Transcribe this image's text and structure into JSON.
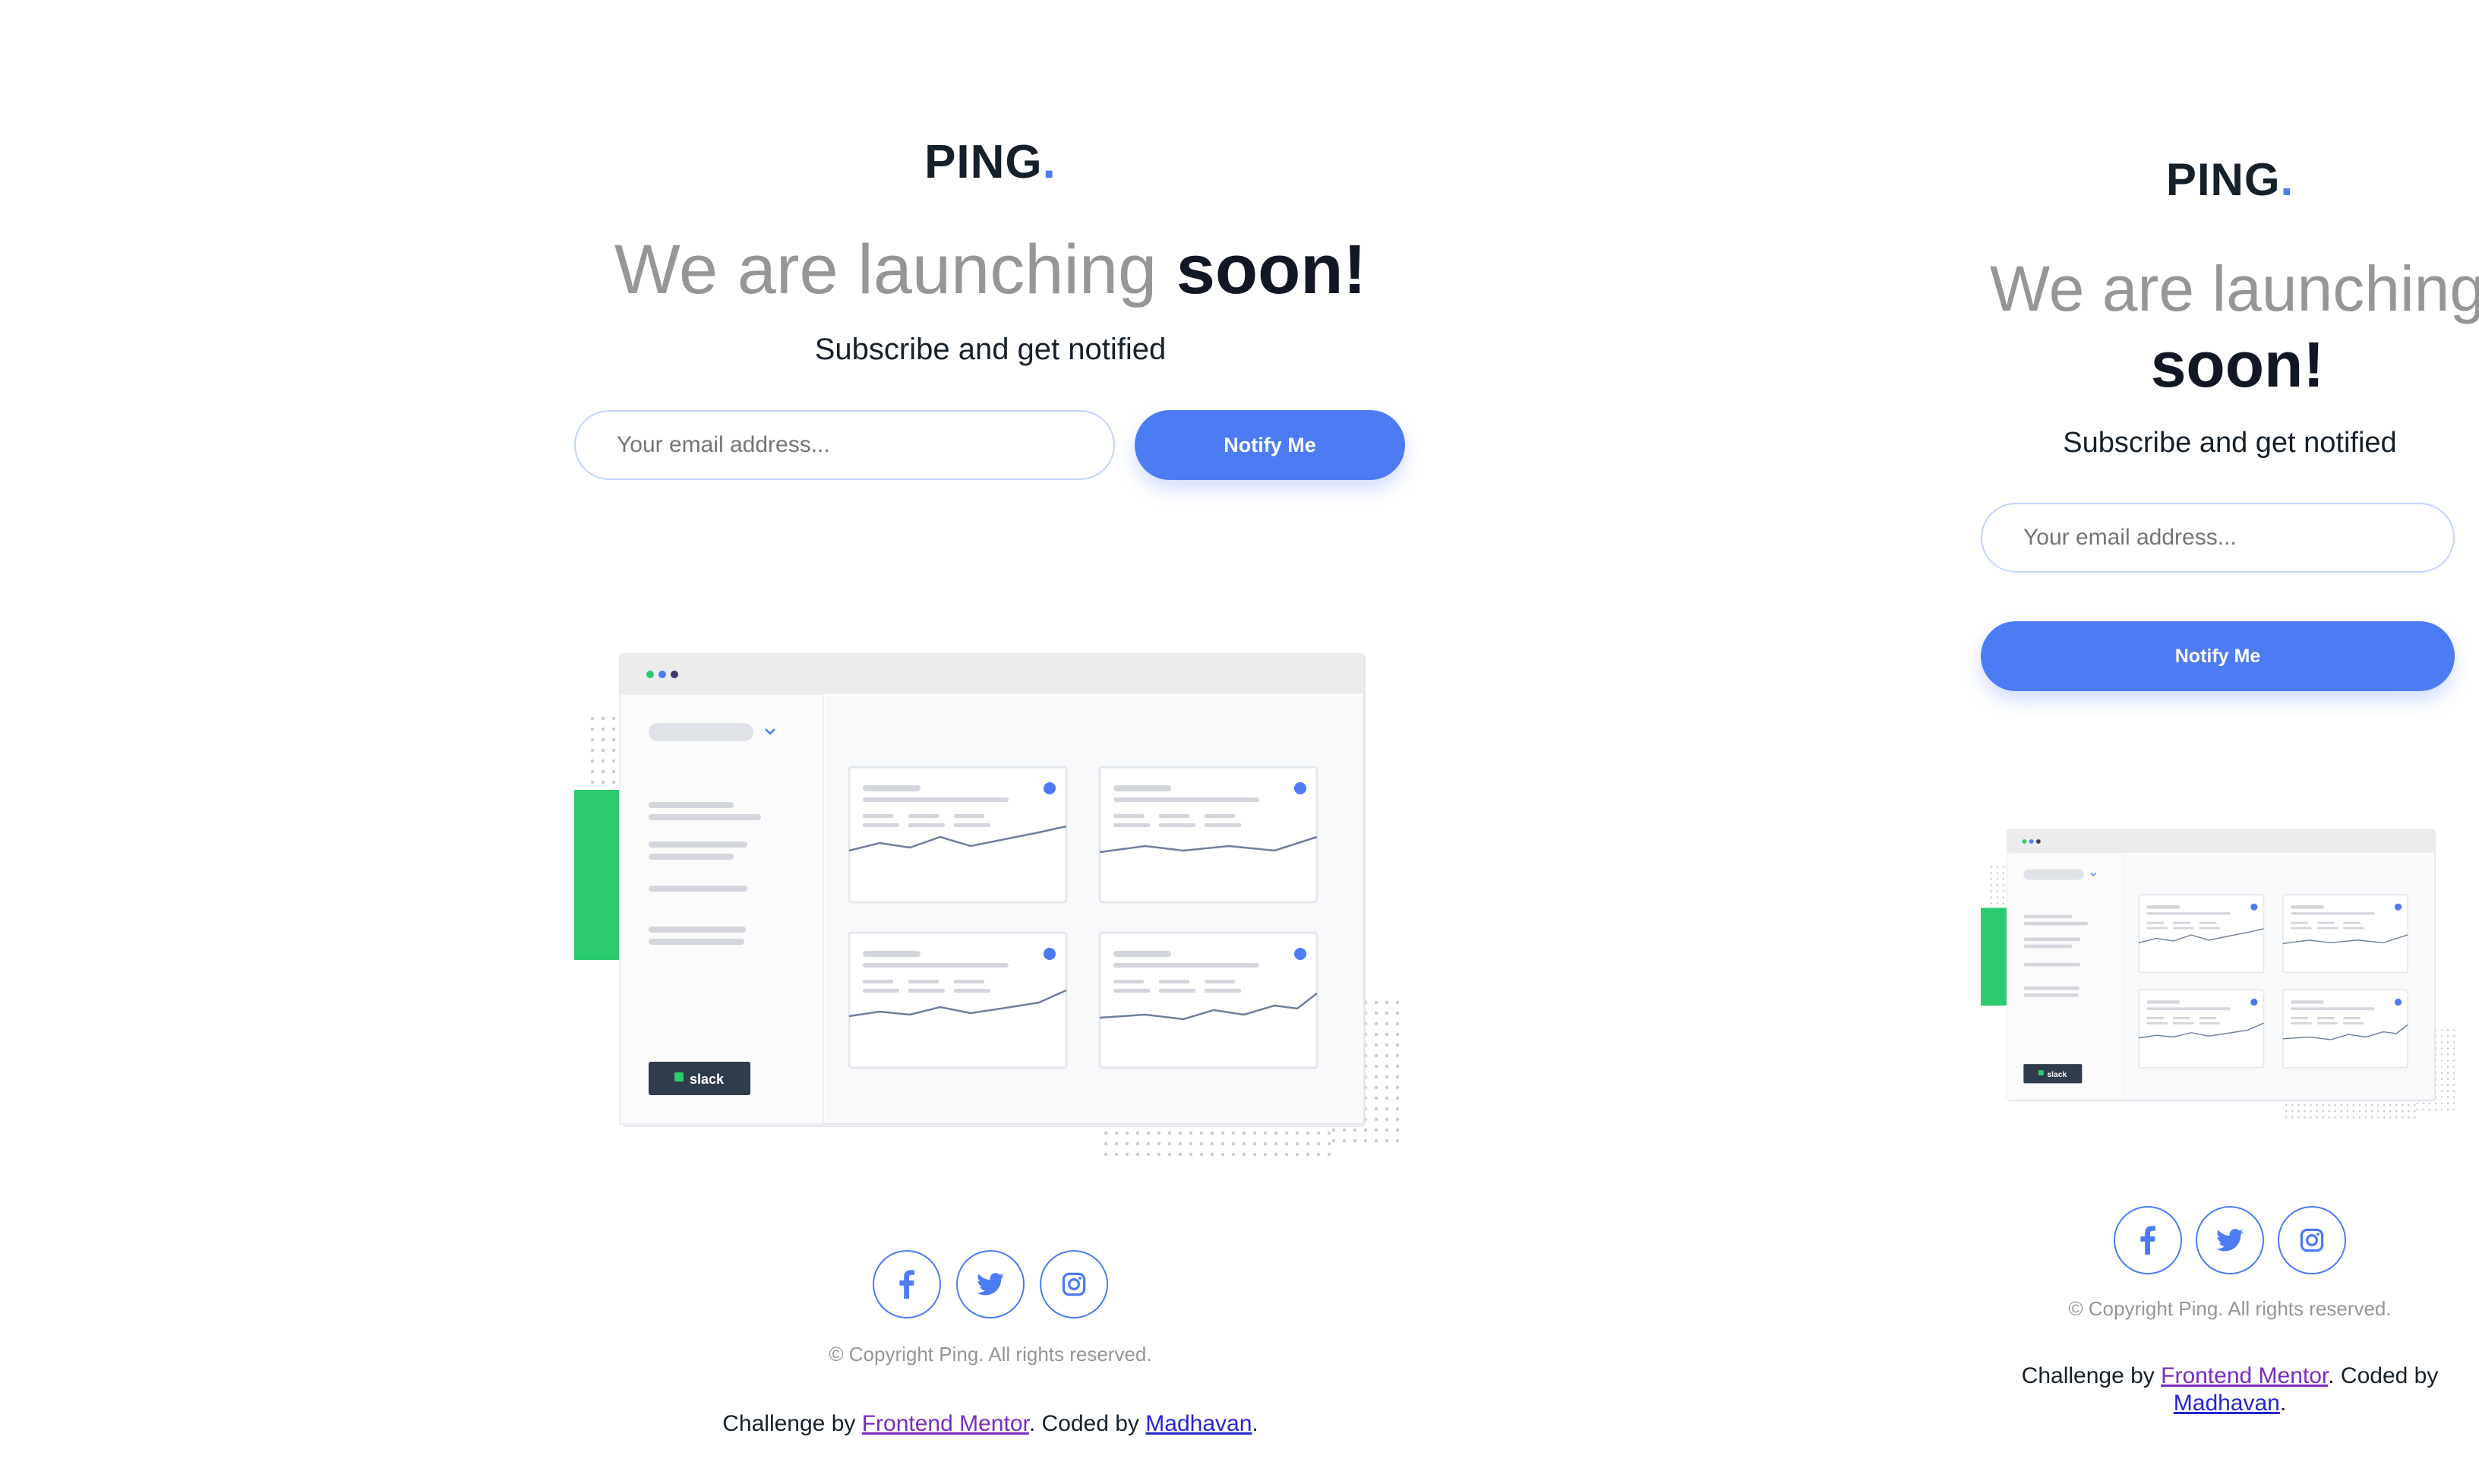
{
  "brand": {
    "name": "PING",
    "dot": "."
  },
  "headline": {
    "light": "We are launching",
    "strong": "soon!"
  },
  "subtitle": "Subscribe and get notified",
  "form": {
    "email_placeholder": "Your email address...",
    "email_value": "",
    "button_label": "Notify Me"
  },
  "illustration": {
    "badge": "slack"
  },
  "social": [
    {
      "icon": "facebook-icon",
      "label": "Facebook"
    },
    {
      "icon": "twitter-icon",
      "label": "Twitter"
    },
    {
      "icon": "instagram-icon",
      "label": "Instagram"
    }
  ],
  "footer": {
    "copyright": "© Copyright Ping. All rights reserved.",
    "credit_prefix": "Challenge by ",
    "credit_link": "Frontend Mentor",
    "credit_middle": ". Coded by ",
    "author_link": "Madhavan",
    "credit_suffix": "."
  },
  "colors": {
    "accent": "#4c7bf3",
    "green": "#2ccb6f",
    "dark": "#15202a",
    "gray": "#969696",
    "border": "#c2d3ff"
  }
}
